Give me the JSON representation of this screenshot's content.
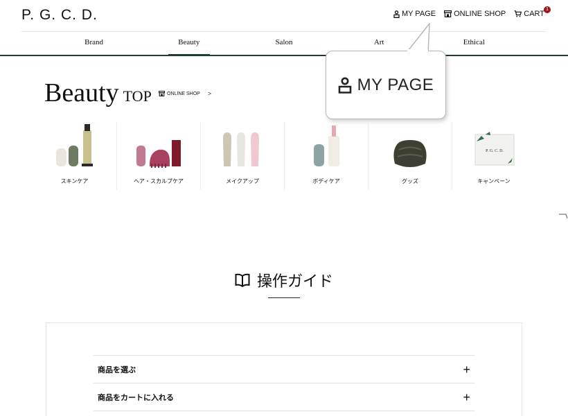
{
  "header": {
    "logo": "P. G. C. D.",
    "nav": {
      "mypage": "MY PAGE",
      "shop": "ONLINE SHOP",
      "cart": "CART",
      "cart_count": "1"
    },
    "categories": [
      "Brand",
      "Beauty",
      "Salon",
      "Art",
      "Ethical"
    ],
    "active_category": "Beauty"
  },
  "callout": {
    "label": "MY PAGE"
  },
  "beauty": {
    "title": "Beauty",
    "title_suffix": "TOP",
    "shop_link": "ONLINE SHOP",
    "shop_arrow": ">",
    "categories": [
      "スキンケア",
      "ヘア・スカルプケア",
      "メイクアップ",
      "ボディケア",
      "グッズ",
      "キャンペーン"
    ],
    "campaign_card_text": "P. G. C. D."
  },
  "guide": {
    "title": "操作ガイド",
    "items": [
      {
        "label": "商品を選ぶ",
        "toggle": "+"
      },
      {
        "label": "商品をカートに入れる",
        "toggle": "+"
      }
    ]
  },
  "colors": {
    "accent_green": "#1e3d2a",
    "badge_red": "#a0121b"
  },
  "icons": [
    "user-icon",
    "shop-icon",
    "cart-icon",
    "book-icon",
    "plus-icon"
  ]
}
